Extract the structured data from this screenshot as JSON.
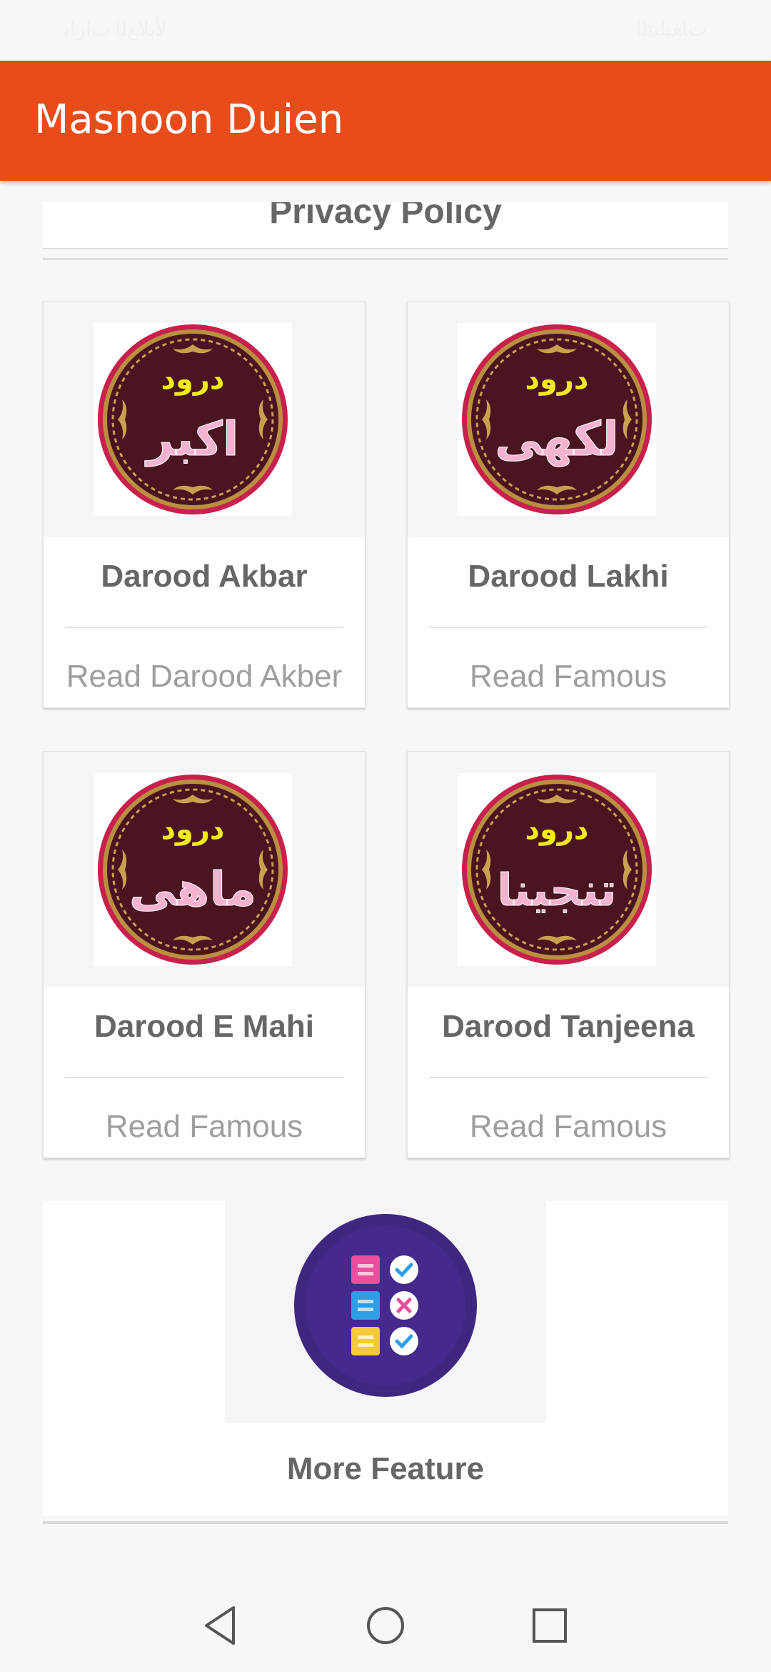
{
  "status": {
    "left_text": "ﻷﺑﻼﻊﻟﺍ ﺕﺍﺭﺎﺑ",
    "right_text": "ﺕﺎﻐﻴﻠﺒﺘﻟﺍ"
  },
  "app_bar": {
    "title": "Masnoon Duien"
  },
  "top_card": {
    "label": "Privacy Policy"
  },
  "cards": [
    {
      "title": "Darood Akbar",
      "subtitle": "Read Darood Akber",
      "icon": "darood-akbar-icon",
      "arabic_top": "درود",
      "arabic_main": "اکبر"
    },
    {
      "title": "Darood Lakhi",
      "subtitle": "Read Famous",
      "icon": "darood-lakhi-icon",
      "arabic_top": "درود",
      "arabic_main": "لکھی"
    },
    {
      "title": "Darood E Mahi",
      "subtitle": "Read Famous",
      "icon": "darood-mahi-icon",
      "arabic_top": "درود",
      "arabic_main": "ماهی"
    },
    {
      "title": "Darood Tanjeena",
      "subtitle": "Read Famous",
      "icon": "darood-tanjeena-icon",
      "arabic_top": "درود",
      "arabic_main": "تنجینا"
    }
  ],
  "feature": {
    "title": "More Feature",
    "icon": "checklist-icon"
  },
  "nav": {
    "back": "back-icon",
    "home": "home-icon",
    "recents": "recents-icon"
  },
  "colors": {
    "accent": "#e84c1a",
    "medallion_ring": "#c8204c",
    "medallion_bg": "#4a1520",
    "arabic_yellow": "#f2ea1c",
    "arabic_pink": "#f5b3cf",
    "feature_circle": "#3f2780"
  }
}
